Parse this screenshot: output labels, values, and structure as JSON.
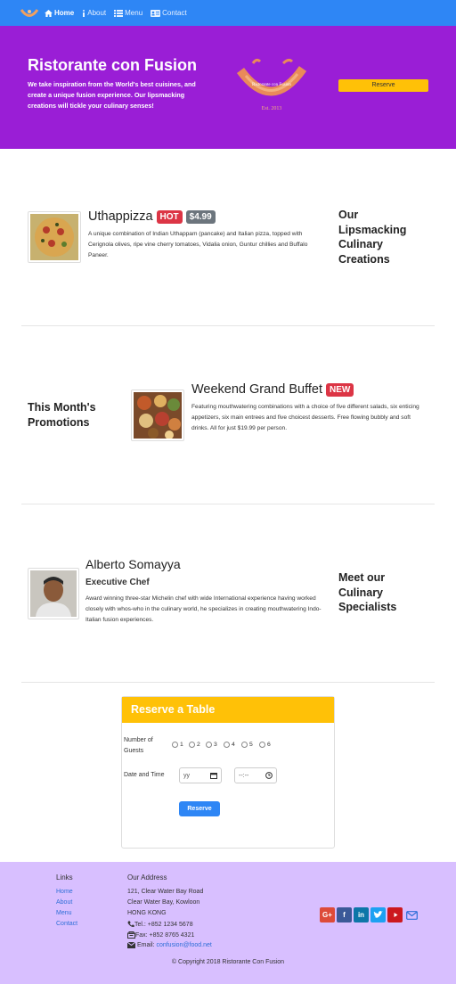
{
  "nav": {
    "items": [
      {
        "label": "Home",
        "icon": "home-icon"
      },
      {
        "label": "About",
        "icon": "info-icon"
      },
      {
        "label": "Menu",
        "icon": "list-icon"
      },
      {
        "label": "Contact",
        "icon": "address-card-icon"
      }
    ]
  },
  "jumbotron": {
    "title": "Ristorante con Fusion",
    "text": "We take inspiration from the World's best cuisines, and create a unique fusion experience. Our lipsmacking creations will tickle your culinary senses!",
    "logo_text": "Ristorante con Fusion",
    "logo_est": "Est. 2013",
    "reserve_label": "Reserve"
  },
  "dish": {
    "name": "Uthappizza",
    "badge_label": "HOT",
    "price": "$4.99",
    "description": "A unique combination of Indian Uthappam (pancake) and Italian pizza, topped with Cerignola olives, ripe vine cherry tomatoes, Vidalia onion, Guntur chillies and Buffalo Paneer.",
    "side_heading": "Our Lipsmacking Culinary Creations"
  },
  "promotion": {
    "side_heading": "This Month's Promotions",
    "name": "Weekend Grand Buffet",
    "badge_label": "NEW",
    "description": "Featuring mouthwatering combinations with a choice of five different salads, six enticing appetizers, six main entrees and five choicest desserts. Free flowing bubbly and soft drinks. All for just $19.99 per person."
  },
  "leader": {
    "name": "Alberto Somayya",
    "designation": "Executive Chef",
    "description": "Award winning three-star Michelin chef with wide International experience having worked closely with whos-who in the culinary world, he specializes in creating mouthwatering Indo-Italian fusion experiences.",
    "side_heading": "Meet our Culinary Specialists"
  },
  "reservation": {
    "header": "Reserve a Table",
    "guests_label": "Number of Guests",
    "guest_options": [
      "1",
      "2",
      "3",
      "4",
      "5",
      "6"
    ],
    "datetime_label": "Date and Time",
    "date_placeholder": "yy",
    "time_placeholder": "--:--",
    "submit_label": "Reserve"
  },
  "footer": {
    "links_heading": "Links",
    "links": [
      "Home",
      "About",
      "Menu",
      "Contact"
    ],
    "address_heading": "Our Address",
    "address_lines": [
      "121, Clear Water Bay Road",
      "Clear Water Bay, Kowloon",
      "HONG KONG"
    ],
    "tel": "Tel.: +852 1234 5678",
    "fax": "Fax: +852 8765 4321",
    "email_label": "Email:",
    "email": "confusion@food.net",
    "copyright": "© Copyright 2018 Ristorante Con Fusion",
    "social_icons": [
      "google-plus-icon",
      "facebook-icon",
      "linkedin-icon",
      "twitter-icon",
      "youtube-icon",
      "mail-icon"
    ]
  },
  "colors": {
    "navbar": "#2e86f5",
    "jumbotron": "#9a1ed6",
    "accent": "#ffc107",
    "footer": "#d8bfff",
    "badge_hot": "#dc3545",
    "badge_price": "#6c757d"
  }
}
